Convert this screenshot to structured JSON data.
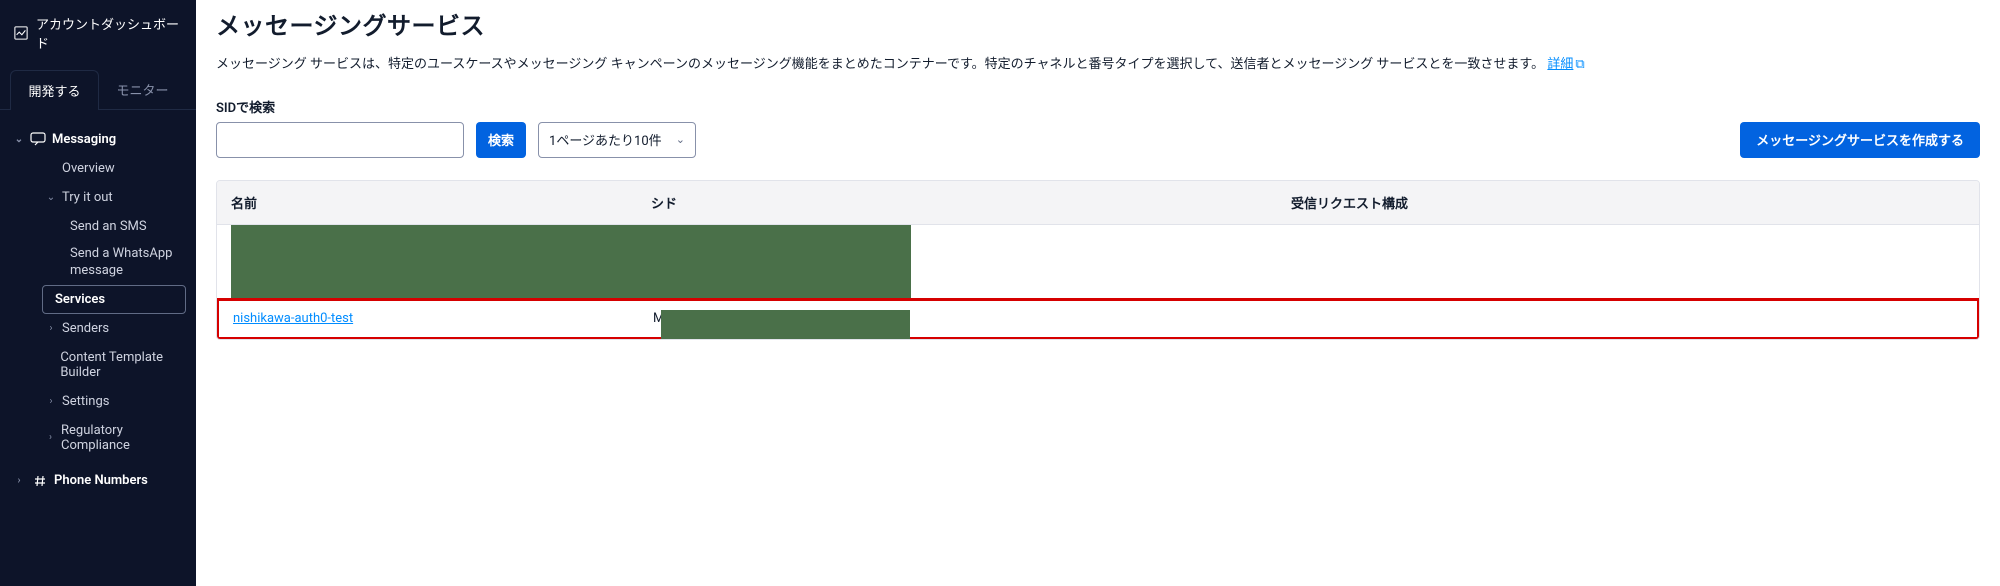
{
  "sidebar": {
    "account_link": "アカウントダッシュボード",
    "tabs": {
      "develop": "開発する",
      "monitor": "モニター"
    },
    "messaging": {
      "label": "Messaging",
      "overview": "Overview",
      "try_it_out": "Try it out",
      "send_sms": "Send an SMS",
      "send_whatsapp": "Send a WhatsApp message",
      "services": "Services",
      "senders": "Senders",
      "content_template": "Content Template Builder",
      "settings": "Settings",
      "regulatory": "Regulatory Compliance"
    },
    "phone_numbers": "Phone Numbers"
  },
  "page": {
    "title": "メッセージングサービス",
    "description": "メッセージング サービスは、特定のユースケースやメッセージング キャンペーンのメッセージング機能をまとめたコンテナーです。特定のチャネルと番号タイプを選択して、送信者とメッセージング サービスとを一致させます。",
    "detail_link": "詳細"
  },
  "search": {
    "label": "SIDで検索",
    "button": "検索",
    "value": ""
  },
  "page_size": {
    "label": "1ページあたり10件"
  },
  "create_button": "メッセージングサービスを作成する",
  "table": {
    "headers": {
      "name": "名前",
      "sid": "シド",
      "request_config": "受信リクエスト構成"
    },
    "rows": [
      {
        "name": "",
        "sid": "",
        "request_config": "",
        "redacted": true
      },
      {
        "name": "nishikawa-auth0-test",
        "sid_prefix": "M",
        "sid_redacted": true,
        "request_config": "",
        "highlighted": true
      }
    ]
  }
}
